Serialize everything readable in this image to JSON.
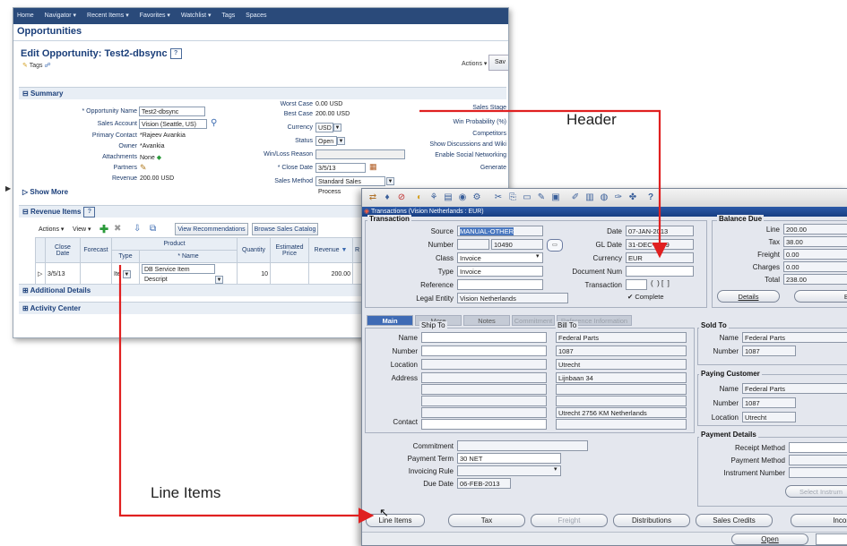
{
  "crm": {
    "topnav": [
      "Home",
      "Navigator ▾",
      "Recent Items ▾",
      "Favorites ▾",
      "Watchlist ▾",
      "Tags",
      "Spaces"
    ],
    "page_title": "Opportunities",
    "edit_title": "Edit Opportunity: Test2-dbsync",
    "help": "?",
    "tags_label": "Tags",
    "actions_label": "Actions ▾",
    "save_label": "Sav",
    "summary_section": "Summary",
    "fields_left": [
      {
        "label": "* Opportunity Name",
        "value": "Test2-dbsync"
      },
      {
        "label": "Sales Account",
        "value": "Vision (Seattle, US)"
      },
      {
        "label": "Primary Contact",
        "value": "*Rajeev Avankia"
      },
      {
        "label": "Owner",
        "value": "*Avankia"
      },
      {
        "label": "Attachments",
        "value": "None"
      },
      {
        "label": "Partners",
        "value": ""
      },
      {
        "label": "Revenue",
        "value": "200.00 USD"
      }
    ],
    "fields_mid": [
      {
        "label": "Worst Case",
        "value": "0.00 USD"
      },
      {
        "label": "Best Case",
        "value": "200.00 USD"
      },
      {
        "label": "Currency",
        "value": "USD"
      },
      {
        "label": "Status",
        "value": "Open"
      },
      {
        "label": "Win/Loss Reason",
        "value": ""
      },
      {
        "label": "* Close Date",
        "value": "3/5/13"
      },
      {
        "label": "Sales Method",
        "value": "Standard Sales Process"
      }
    ],
    "fields_right": [
      "Sales Stage",
      "Win Probability (%)",
      "Competitors",
      "Show Discussions and Wiki",
      "Enable Social Networking",
      "Generate"
    ],
    "show_more": "Show More",
    "revenue_section": "Revenue Items",
    "rev_toolbar": {
      "actions": "Actions ▾",
      "view": "View ▾",
      "view_recs": "View Recommendations",
      "browse": "Browse Sales Catalog"
    },
    "rev_headers": {
      "close_date": "Close Date",
      "forecast": "Forecast",
      "product": "Product",
      "type": "Type",
      "name": "* Name",
      "quantity": "Quantity",
      "est_price": "Estimated Price",
      "revenue": "Revenue",
      "r": "R"
    },
    "rev_row": {
      "close_date": "3/5/13",
      "type": "Ite",
      "name": "DB Service Item Descript",
      "quantity": "10",
      "revenue": "200.00"
    },
    "additional_details": "Additional Details",
    "activity_center": "Activity Center"
  },
  "forms": {
    "title": "Transactions (Vision Netherlands : EUR)",
    "transaction_group": "Transaction",
    "source_label": "Source",
    "source_value": "MANUAL-OTHER",
    "number_label": "Number",
    "number_value": "10490",
    "class_label": "Class",
    "class_value": "Invoice",
    "type_label": "Type",
    "type_value": "Invoice",
    "reference_label": "Reference",
    "reference_value": "",
    "legal_entity_label": "Legal Entity",
    "legal_entity_value": "Vision Netherlands",
    "date_label": "Date",
    "date_value": "07-JAN-2013",
    "gl_date_label": "GL Date",
    "gl_date_value": "31-DEC-2009",
    "currency_label": "Currency",
    "currency_value": "EUR",
    "doc_num_label": "Document Num",
    "doc_num_value": "",
    "transaction_label": "Transaction",
    "transaction_value": "",
    "complete_label": "Complete",
    "balance_group": "Balance Due",
    "balance": [
      {
        "label": "Line",
        "value": "200.00"
      },
      {
        "label": "Tax",
        "value": "38.00"
      },
      {
        "label": "Freight",
        "value": "0.00"
      },
      {
        "label": "Charges",
        "value": "0.00"
      },
      {
        "label": "Total",
        "value": "238.00"
      }
    ],
    "details_button": "Details",
    "be_button": "Be",
    "tabs": [
      "Main",
      "More",
      "Notes",
      "Commitment",
      "Reference Information"
    ],
    "ship_to": "Ship To",
    "bill_to": "Bill To",
    "sold_to": "Sold To",
    "addr_labels": [
      "Name",
      "Number",
      "Location",
      "Address",
      "Contact"
    ],
    "bill_values": [
      "Federal Parts",
      "1087",
      "Utrecht",
      "Lijnbaan 34",
      "",
      "",
      "Utrecht 2756 KM Netherlands"
    ],
    "sold_to_name": "Federal Parts",
    "sold_to_number": "1087",
    "paying_group": "Paying Customer",
    "paying_name": "Federal Parts",
    "paying_number": "1087",
    "paying_location": "Utrecht",
    "commitment_label": "Commitment",
    "payment_term_label": "Payment Term",
    "payment_term_value": "30 NET",
    "invoicing_rule_label": "Invoicing Rule",
    "due_date_label": "Due Date",
    "due_date_value": "06-FEB-2013",
    "payment_group": "Payment Details",
    "receipt_method": "Receipt Method",
    "payment_method": "Payment Method",
    "instrument_number": "Instrument Number",
    "select_instrument": "Select Instrum",
    "buttons": [
      "Line Items",
      "Tax",
      "Freight",
      "Distributions",
      "Sales Credits",
      "Incom"
    ],
    "open_button": "Open"
  },
  "annotations": {
    "header": "Header",
    "line_items": "Line Items"
  },
  "colors": {
    "arrow": "#e02020",
    "crm_nav": "#2a4a7a",
    "forms_title": "#1f4a96",
    "active_tab": "#3f6bb5"
  }
}
